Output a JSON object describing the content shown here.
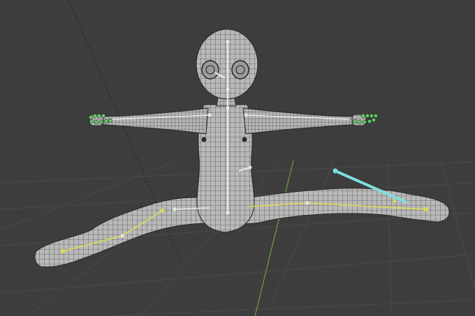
{
  "viewport": {
    "background_color": "#3d3d3d",
    "grid_color": "#4a4a4a",
    "axis_y_color": "#6a9a3a",
    "axis_x_color": "#222222"
  },
  "mesh": {
    "fill_color": "#b9b9b9",
    "wire_color": "#2a2a2a",
    "vertex_color": "#1a1a1a"
  },
  "armature": {
    "bone_color": "#e8e8e8",
    "selected_bone_color": "#d8d860",
    "active_bone_color": "#7fdede",
    "hand_control_color": "#66cc66",
    "bones": [
      "spine",
      "neck",
      "head",
      "left-arm",
      "right-arm",
      "left-thigh",
      "left-shin",
      "right-thigh",
      "right-shin",
      "right-foot-ik"
    ]
  }
}
